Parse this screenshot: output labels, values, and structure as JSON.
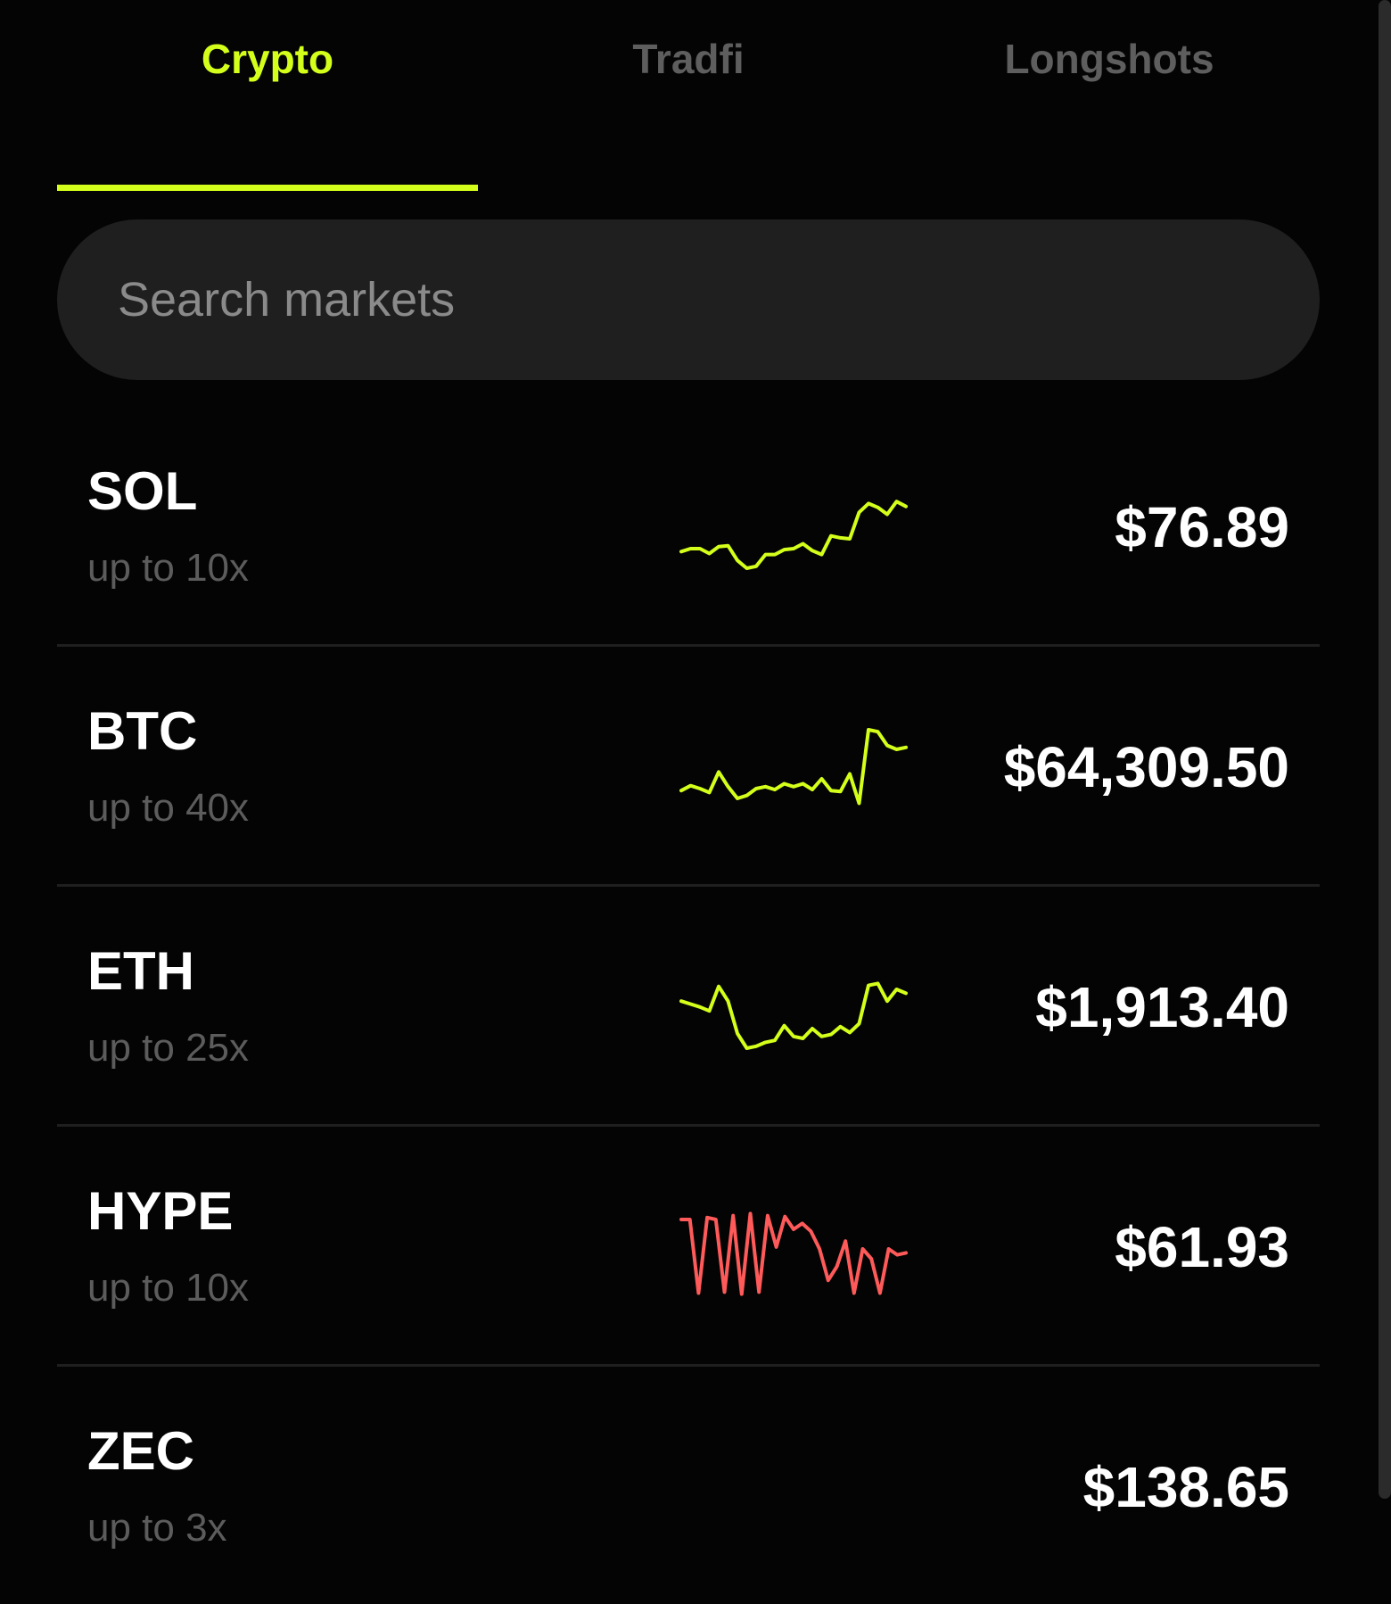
{
  "colors": {
    "accent": "#d4ff1a",
    "up": "#d4ff1a",
    "down": "#ff5a5a"
  },
  "tabs": [
    {
      "label": "Crypto",
      "active": true
    },
    {
      "label": "Tradfi",
      "active": false
    },
    {
      "label": "Longshots",
      "active": false
    }
  ],
  "search": {
    "placeholder": "Search markets"
  },
  "markets": [
    {
      "ticker": "SOL",
      "leverage": "up to 10x",
      "price": "$76.89",
      "trend": "up",
      "spark": [
        0.27,
        0.3,
        0.3,
        0.25,
        0.32,
        0.33,
        0.18,
        0.1,
        0.12,
        0.24,
        0.24,
        0.29,
        0.3,
        0.35,
        0.28,
        0.24,
        0.43,
        0.41,
        0.4,
        0.67,
        0.76,
        0.72,
        0.65,
        0.78,
        0.73
      ]
    },
    {
      "ticker": "BTC",
      "leverage": "up to 40x",
      "price": "$64,309.50",
      "trend": "up",
      "spark": [
        0.28,
        0.33,
        0.3,
        0.26,
        0.47,
        0.32,
        0.2,
        0.23,
        0.3,
        0.32,
        0.29,
        0.35,
        0.32,
        0.35,
        0.29,
        0.4,
        0.28,
        0.27,
        0.45,
        0.15,
        0.9,
        0.88,
        0.74,
        0.7,
        0.72
      ]
    },
    {
      "ticker": "ETH",
      "leverage": "up to 25x",
      "price": "$1,913.40",
      "trend": "up",
      "spark": [
        0.58,
        0.55,
        0.52,
        0.48,
        0.73,
        0.58,
        0.25,
        0.1,
        0.12,
        0.16,
        0.18,
        0.33,
        0.22,
        0.2,
        0.3,
        0.22,
        0.24,
        0.32,
        0.26,
        0.35,
        0.74,
        0.76,
        0.58,
        0.7,
        0.66
      ]
    },
    {
      "ticker": "HYPE",
      "leverage": "up to 10x",
      "price": "$61.93",
      "trend": "down",
      "spark": [
        0.8,
        0.8,
        0.05,
        0.82,
        0.8,
        0.06,
        0.84,
        0.04,
        0.86,
        0.06,
        0.84,
        0.52,
        0.83,
        0.7,
        0.76,
        0.68,
        0.5,
        0.18,
        0.32,
        0.58,
        0.05,
        0.5,
        0.4,
        0.05,
        0.5,
        0.44,
        0.46
      ]
    },
    {
      "ticker": "ZEC",
      "leverage": "up to 3x",
      "price": "$138.65",
      "trend": "up",
      "spark": []
    }
  ]
}
